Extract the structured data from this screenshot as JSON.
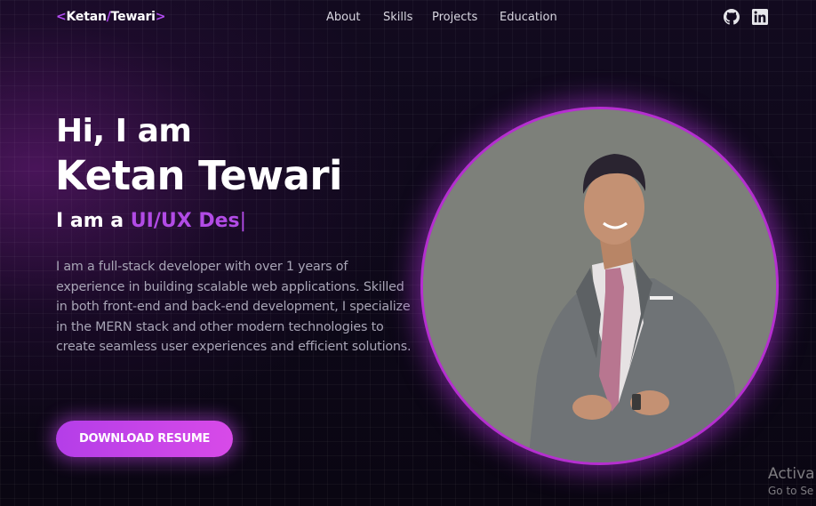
{
  "navbar": {
    "logo": {
      "open": "<",
      "first": "Ketan",
      "slash": "/",
      "last": "Tewari",
      "close": ">"
    },
    "links": [
      {
        "label": "About"
      },
      {
        "label": "Skills"
      },
      {
        "label": "Projects"
      },
      {
        "label": "Education"
      }
    ],
    "social": [
      {
        "icon": "github-icon"
      },
      {
        "icon": "linkedin-icon"
      }
    ]
  },
  "hero": {
    "greeting": "Hi, I am",
    "name": "Ketan Tewari",
    "role_prefix": "I am a ",
    "role_typed": "UI/UX Des",
    "role_cursor": "|",
    "description": "I am a full-stack developer with over 1 years of experience in building scalable web applications. Skilled in both front-end and back-end development, I specialize in the MERN stack and other modern technologies to create seamless user experiences and efficient solutions.",
    "resume_button": "DOWNLOAD RESUME"
  },
  "photo": {
    "icon": "profile-photo"
  },
  "watermark": {
    "title": "Activa",
    "subtitle": "Go to Se"
  },
  "colors": {
    "accent": "#b24be6",
    "button_gradient_start": "#b43ee8",
    "button_gradient_end": "#d84ae8",
    "photo_border": "#b52fd0",
    "background": "#0b0714"
  }
}
